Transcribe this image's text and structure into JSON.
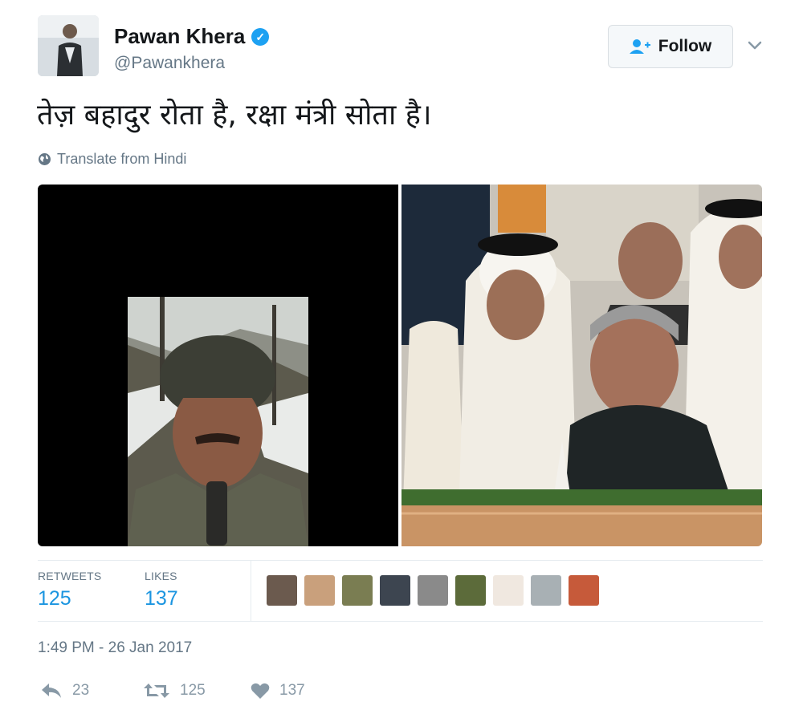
{
  "author": {
    "name": "Pawan Khera",
    "handle": "@Pawankhera",
    "verified_icon": "verified-badge-icon"
  },
  "follow_button": {
    "label": "Follow",
    "icon": "add-user-icon"
  },
  "tweet": {
    "text": "तेज़ बहादुर रोता है, रक्षा मंत्री सोता है।",
    "translate_label": "Translate from Hindi"
  },
  "stats": {
    "retweets_label": "RETWEETS",
    "retweets_value": "125",
    "likes_label": "LIKES",
    "likes_value": "137"
  },
  "timestamp": "1:49 PM - 26 Jan 2017",
  "actions": {
    "reply_count": "23",
    "retweet_count": "125",
    "like_count": "137"
  },
  "colors": {
    "accent": "#1b95e0",
    "muted": "#657786",
    "verified": "#1da1f2"
  }
}
